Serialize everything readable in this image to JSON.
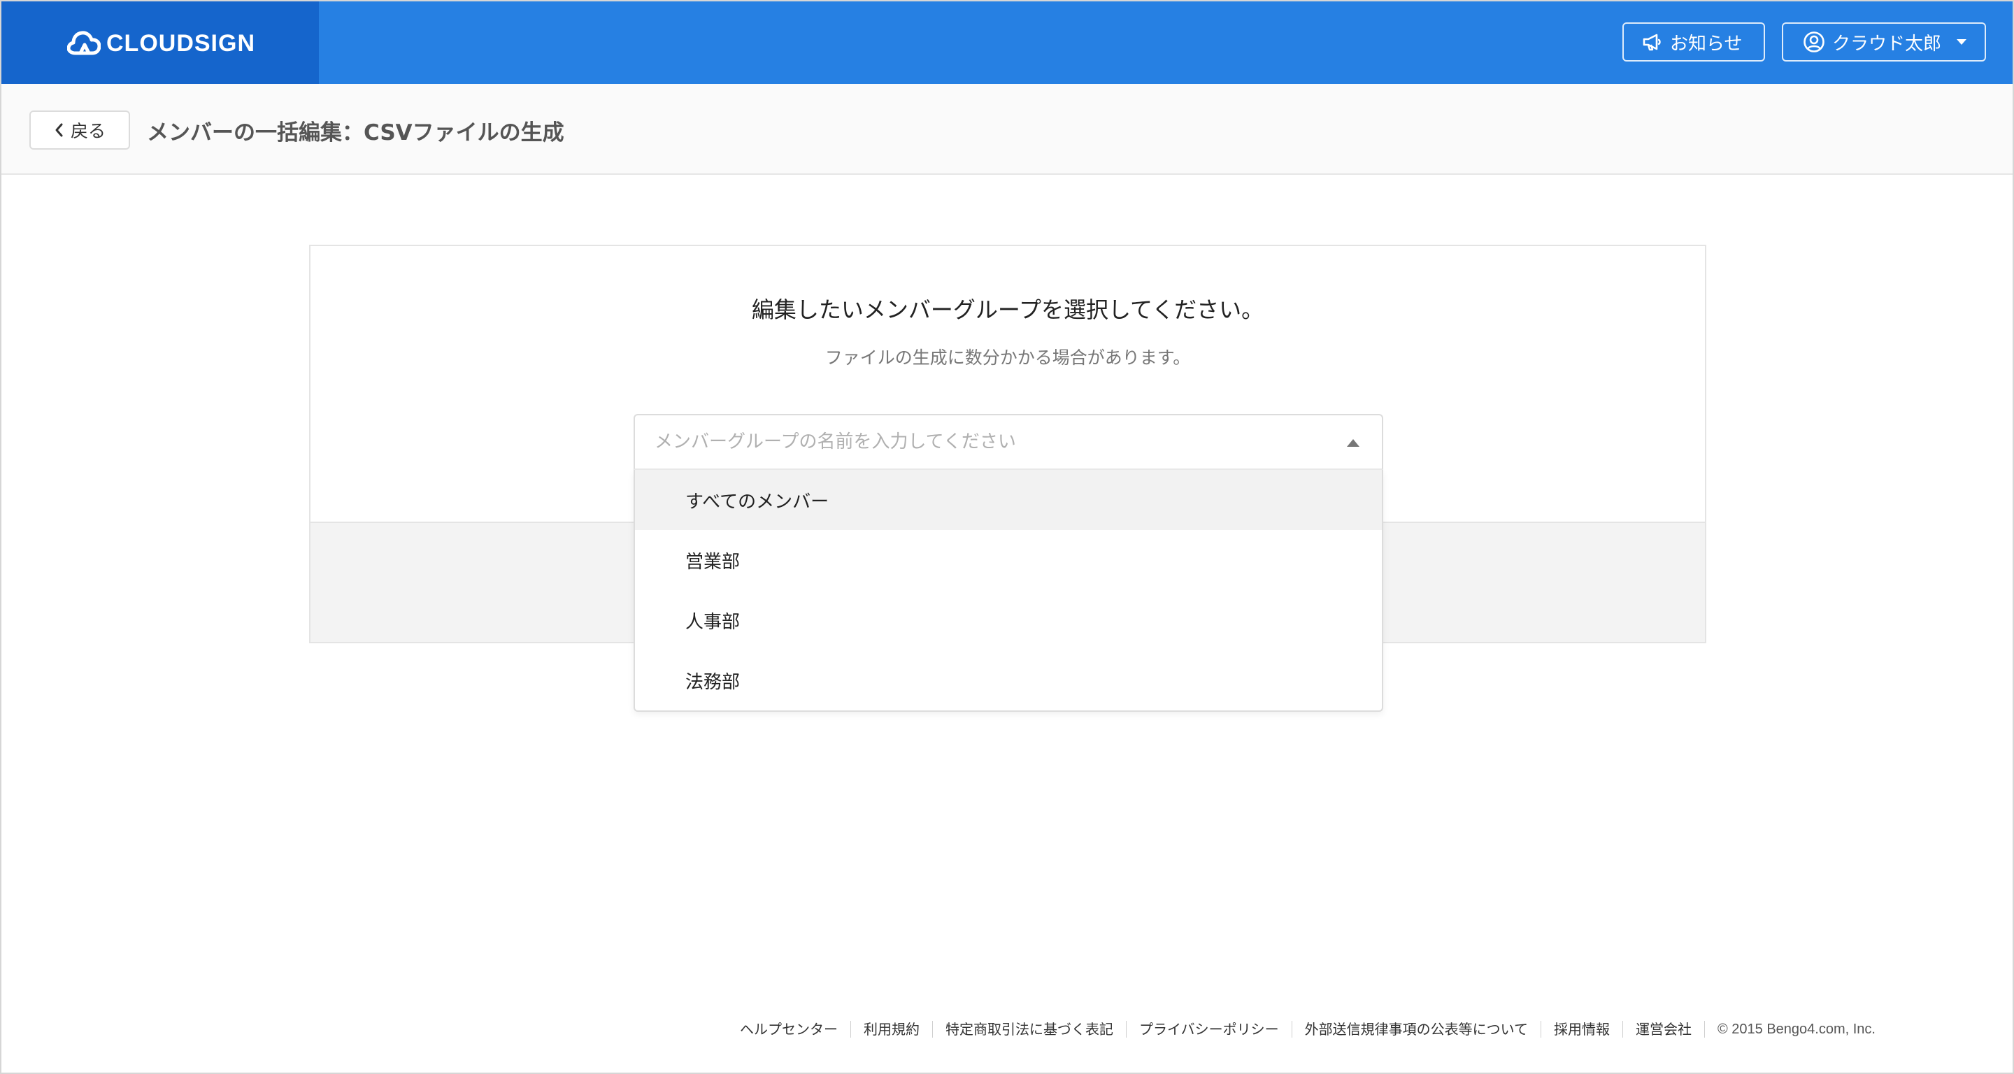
{
  "header": {
    "logo_text": "CLOUDSIGN",
    "news_label": "お知らせ",
    "user_label": "クラウド太郎",
    "accent": "#2680e3",
    "logo_bg": "#1565cc"
  },
  "subheader": {
    "back_label": "戻る",
    "title": "メンバーの一括編集：CSVファイルの生成"
  },
  "card": {
    "heading": "編集したいメンバーグループを選択してください。",
    "subtext": "ファイルの生成に数分かかる場合があります。"
  },
  "select": {
    "placeholder": "メンバーグループの名前を入力してください",
    "options": [
      {
        "label": "すべてのメンバー"
      },
      {
        "label": "営業部"
      },
      {
        "label": "人事部"
      },
      {
        "label": "法務部"
      }
    ]
  },
  "footer": {
    "links": [
      {
        "label": "ヘルプセンター"
      },
      {
        "label": "利用規約"
      },
      {
        "label": "特定商取引法に基づく表記"
      },
      {
        "label": "プライバシーポリシー"
      },
      {
        "label": "外部送信規律事項の公表等について"
      },
      {
        "label": "採用情報"
      },
      {
        "label": "運営会社"
      }
    ],
    "copyright": "© 2015 Bengo4.com, Inc."
  },
  "icons": {
    "logo": "cloud-logo-icon",
    "news": "megaphone-icon",
    "user": "user-circle-icon",
    "back": "chevron-left-icon",
    "select": "caret-up-icon"
  }
}
